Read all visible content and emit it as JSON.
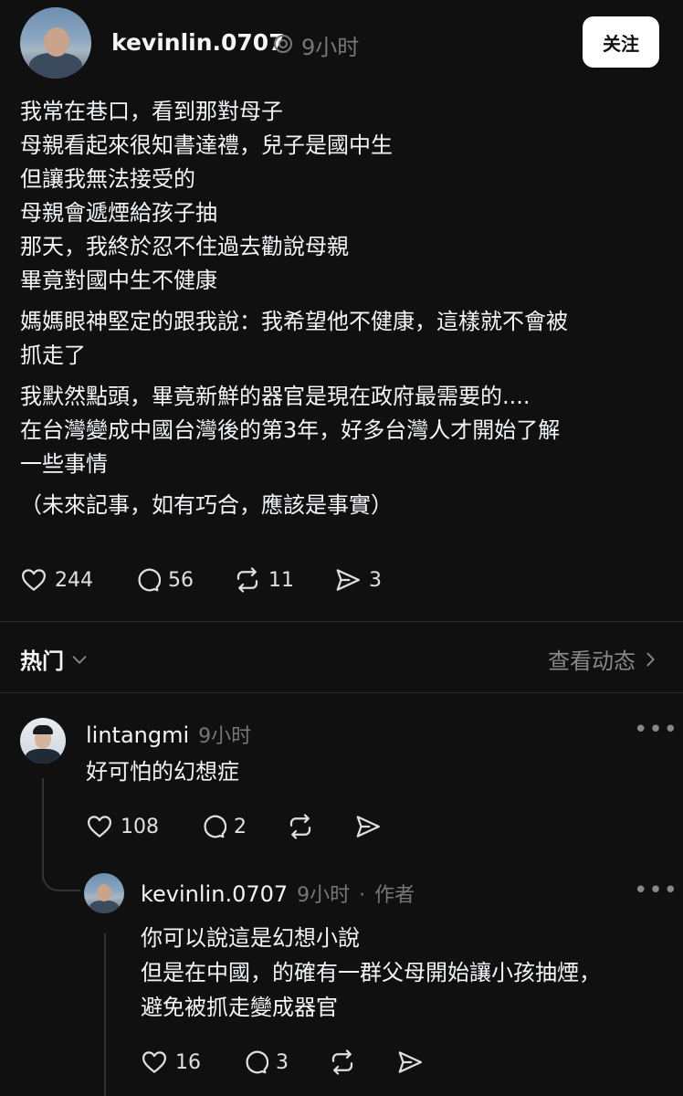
{
  "post": {
    "author": "kevinlin.0707",
    "time": "9小时",
    "follow_label": "关注",
    "paragraphs": [
      [
        "我常在巷口，看到那對母子",
        "母親看起來很知書達禮，兒子是國中生",
        "但讓我無法接受的",
        "母親會遞煙給孩子抽",
        "那天，我終於忍不住過去勸說母親",
        "畢竟對國中生不健康"
      ],
      [
        "媽媽眼神堅定的跟我說：我希望他不健康，這樣就不會被",
        "抓走了"
      ],
      [
        "我默然點頭，畢竟新鮮的器官是現在政府最需要的....",
        "在台灣變成中國台灣後的第3年，好多台灣人才開始了解",
        "一些事情"
      ],
      [
        "（未來記事，如有巧合，應該是事實）"
      ]
    ],
    "likes": "244",
    "comments": "56",
    "reposts": "11",
    "shares": "3"
  },
  "section": {
    "sort_label": "热门",
    "view_activity": "查看动态"
  },
  "replies": [
    {
      "author": "lintangmi",
      "time": "9小时",
      "lines": [
        "好可怕的幻想症"
      ],
      "likes": "108",
      "comments": "2"
    },
    {
      "author": "kevinlin.0707",
      "time": "9小时",
      "author_tag": "作者",
      "lines": [
        "你可以說這是幻想小說",
        "但是在中國，的確有一群父母開始讓小孩抽煙，",
        "避免被抓走變成器官"
      ],
      "likes": "16",
      "comments": "3"
    }
  ],
  "icons": [
    "heart-icon",
    "comment-icon",
    "repost-icon",
    "share-icon",
    "verified-icon",
    "chevron-down-icon",
    "chevron-right-icon",
    "more-icon"
  ]
}
